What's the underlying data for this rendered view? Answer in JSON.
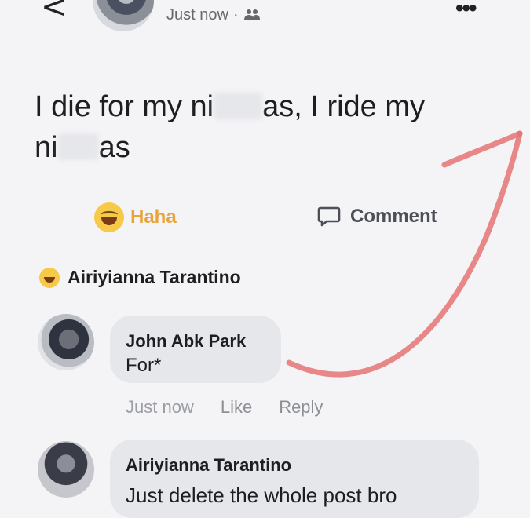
{
  "header": {
    "time": "Just now",
    "separator": "·",
    "audience_icon": "friends-icon",
    "more_icon": "more-icon",
    "back_icon": "back-arrow-icon",
    "more_glyph": "•••",
    "back_glyph": "<"
  },
  "post": {
    "text_part1": "I die for my ni",
    "text_part2": "as, I ride my",
    "text_part3": "ni",
    "text_part4": "as"
  },
  "actions": {
    "haha_label": "Haha",
    "comment_label": "Comment"
  },
  "reaction_line": {
    "name": "Airiyianna Tarantino"
  },
  "comments": [
    {
      "author": "John Abk Park",
      "text": "For*",
      "time": "Just now",
      "like": "Like",
      "reply": "Reply"
    },
    {
      "author": "Airiyianna Tarantino",
      "text": "Just delete the whole post bro"
    }
  ],
  "colors": {
    "haha": "#e8a33a",
    "annotation_arrow": "#e57373"
  }
}
